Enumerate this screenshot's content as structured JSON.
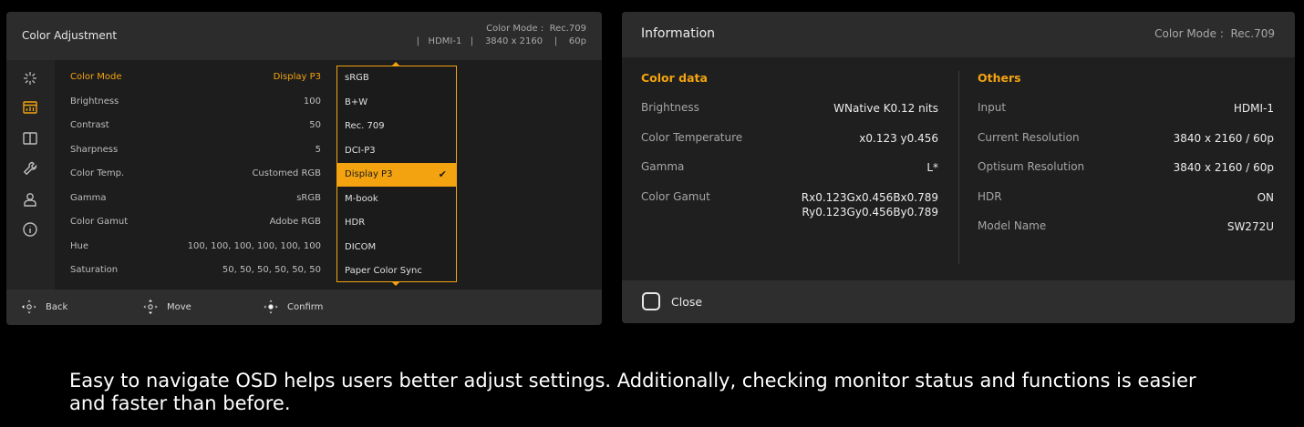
{
  "color_adjustment": {
    "title": "Color Adjustment",
    "status_line1": "Color Mode :  Rec.709",
    "status_line2": "|   HDMI-1   |    3840 x 2160    |    60p",
    "sidebar_icons": [
      "color-adjust-icon",
      "picture-mode-icon",
      "split-screen-icon",
      "wrench-icon",
      "user-icon",
      "info-icon"
    ],
    "settings": [
      {
        "label": "Color Mode",
        "value": "Display P3"
      },
      {
        "label": "Brightness",
        "value": "100"
      },
      {
        "label": "Contrast",
        "value": "50"
      },
      {
        "label": "Sharpness",
        "value": "5"
      },
      {
        "label": "Color Temp.",
        "value": "Customed RGB"
      },
      {
        "label": "Gamma",
        "value": "sRGB"
      },
      {
        "label": "Color Gamut",
        "value": "Adobe RGB"
      },
      {
        "label": "Hue",
        "value": "100, 100, 100, 100, 100, 100"
      },
      {
        "label": "Saturation",
        "value": "50, 50, 50, 50, 50, 50"
      }
    ],
    "dropdown_options": [
      "sRGB",
      "B+W",
      "Rec. 709",
      "DCI-P3",
      "Display P3",
      "M-book",
      "HDR",
      "DICOM",
      "Paper Color Sync"
    ],
    "dropdown_selected": "Display P3",
    "checkmark": "✔",
    "footer": {
      "back": "Back",
      "move": "Move",
      "confirm": "Confirm"
    }
  },
  "information": {
    "title": "Information",
    "color_mode": "Color Mode :  Rec.709",
    "color_data": {
      "title": "Color data",
      "rows": [
        {
          "label": "Brightness",
          "value": "WNative K0.12 nits"
        },
        {
          "label": "Color Temperature",
          "value": "x0.123 y0.456"
        },
        {
          "label": "Gamma",
          "value": "L*"
        },
        {
          "label": "Color Gamut",
          "value_line1": "Rx0.123Gx0.456Bx0.789",
          "value_line2": "Ry0.123Gy0.456By0.789"
        }
      ]
    },
    "others": {
      "title": "Others",
      "rows": [
        {
          "label": "Input",
          "value": "HDMI-1"
        },
        {
          "label": "Current Resolution",
          "value": "3840 x 2160 / 60p"
        },
        {
          "label": "Optisum Resolution",
          "value": "3840 x 2160 / 60p"
        },
        {
          "label": "HDR",
          "value": "ON"
        },
        {
          "label": "Model Name",
          "value": "SW272U"
        }
      ]
    },
    "close_label": "Close"
  },
  "caption": "Easy to navigate OSD helps users better adjust settings. Additionally, checking monitor status and functions is easier and faster than before.",
  "colors": {
    "accent": "#f3a30f",
    "background": "#000000",
    "panel": "#1d1d1d",
    "header": "#2c2c2c"
  }
}
